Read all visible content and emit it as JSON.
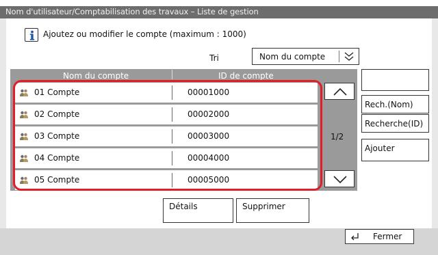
{
  "title_bar": {
    "text": "Nom d'utilisateur/Comptabilisation des travaux – Liste de gestion"
  },
  "info": {
    "text": "Ajoutez ou modifier le compte (maximum : 1000)",
    "icon": "info-icon"
  },
  "sort": {
    "label": "Tri",
    "selected": "Nom du compte"
  },
  "list": {
    "columns": [
      "Nom du compte",
      "ID de compte"
    ],
    "rows": [
      {
        "name": "01  Compte",
        "id": "00001000"
      },
      {
        "name": "02  Compte",
        "id": "00002000"
      },
      {
        "name": "03  Compte",
        "id": "00003000"
      },
      {
        "name": "04  Compte",
        "id": "00004000"
      },
      {
        "name": "05  Compte",
        "id": "00005000"
      }
    ],
    "page": "1/2"
  },
  "side_buttons": {
    "search_name": "Rech.(Nom)",
    "search_id": "Recherche(ID)",
    "add": "Ajouter"
  },
  "bottom_buttons": {
    "details": "Détails",
    "delete": "Supprimer"
  },
  "footer": {
    "close": "Fermer"
  },
  "colors": {
    "highlight": "#e11d2a",
    "title_bar": "#6d6d6d",
    "list_header": "#9a9a9a"
  }
}
